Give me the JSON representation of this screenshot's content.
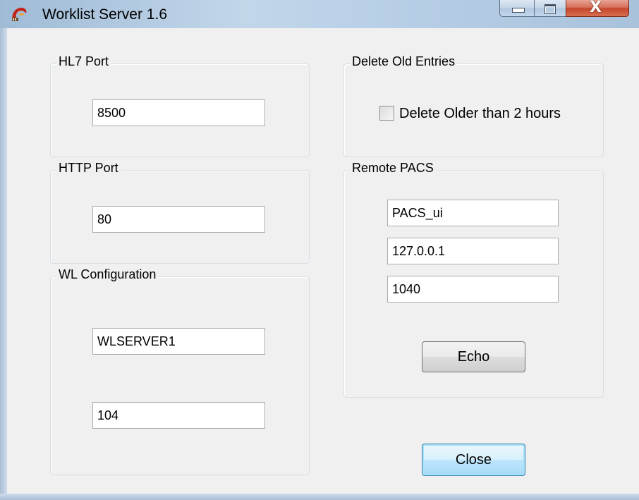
{
  "window": {
    "title": "Worklist Server 1.6",
    "icons": {
      "app": "app-logo-icon",
      "minimize": "minimize-icon",
      "maximize": "maximize-icon",
      "close": "close-icon"
    },
    "close_glyph": "X"
  },
  "hl7_port": {
    "label": "HL7 Port",
    "value": "8500"
  },
  "http_port": {
    "label": "HTTP Port",
    "value": "80"
  },
  "wl_configuration": {
    "label": "WL Configuration",
    "ae_title": "WLSERVER1",
    "port": "104"
  },
  "delete_old_entries": {
    "label": "Delete Old Entries",
    "checkbox_label": "Delete Older than 2 hours",
    "checked": false
  },
  "remote_pacs": {
    "label": "Remote PACS",
    "ae_title": "PACS_ui",
    "host": "127.0.0.1",
    "port": "1040",
    "echo_label": "Echo"
  },
  "close_label": "Close",
  "colors": {
    "titlebar": "#c2d6ea",
    "close_button": "#c4462d",
    "default_button": "#bee6fd",
    "background": "#f0f0f0"
  }
}
